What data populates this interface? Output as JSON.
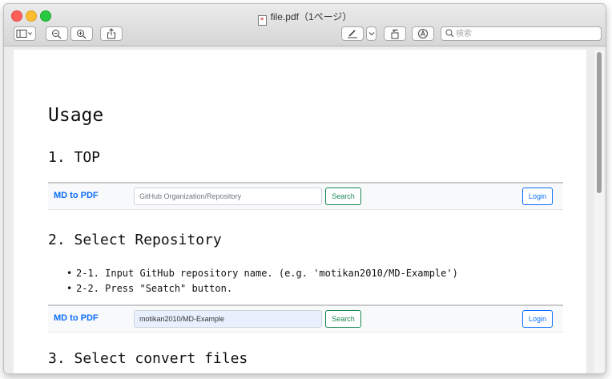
{
  "window": {
    "title": "file.pdf（1ページ）",
    "search_placeholder": "検索"
  },
  "toolbar": {
    "sidebar_icon": "sidebar-icon",
    "zoom_out_icon": "zoom-out-icon",
    "zoom_in_icon": "zoom-in-icon",
    "share_icon": "share-icon",
    "markup_icon": "pen-icon",
    "rotate_icon": "rotate-icon",
    "annotate_icon": "annotate-icon",
    "search_icon": "search-icon"
  },
  "document": {
    "heading": "Usage",
    "section1": "1. TOP",
    "section2": "2. Select Repository",
    "bullets": [
      "2-1. Input GitHub repository name. (e.g. 'motikan2010/MD-Example')",
      "2-2. Press \"Seatch\" button."
    ],
    "section3": "3. Select convert files",
    "navbar1": {
      "brand": "MD to PDF",
      "input_placeholder": "GitHub Organization/Repository",
      "search_label": "Search",
      "login_label": "Login"
    },
    "navbar2": {
      "brand": "MD to PDF",
      "input_value": "motikan2010/MD-Example",
      "search_label": "Search",
      "login_label": "Login"
    }
  },
  "colors": {
    "brand": "#0d6efd",
    "search": "#198754",
    "traffic_close": "#fe5f57",
    "traffic_min": "#febc2e",
    "traffic_max": "#28c840"
  }
}
